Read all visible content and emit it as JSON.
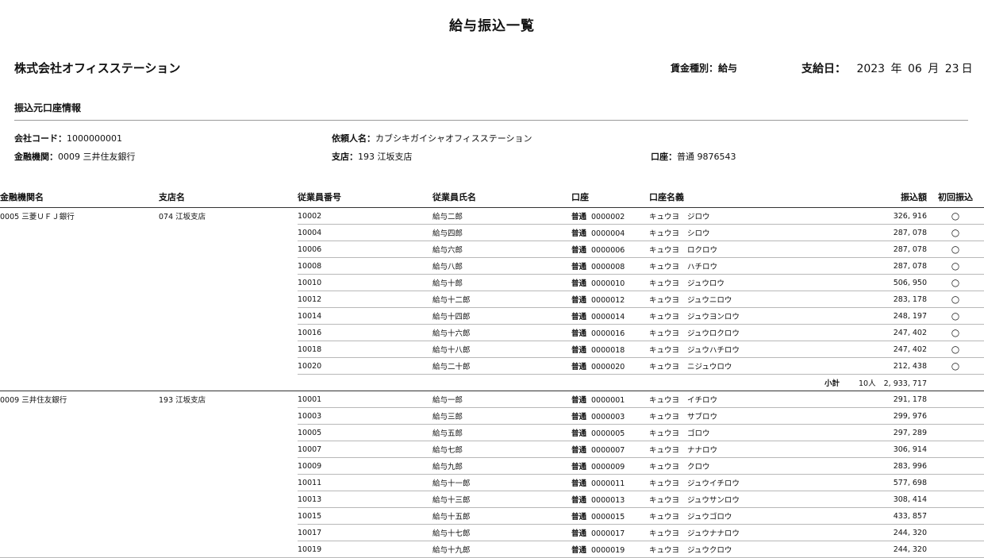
{
  "report": {
    "title": "給与振込一覧",
    "company": "株式会社オフィスステーション",
    "wage_type": "賃金種別：給与",
    "payday_label": "支給日：",
    "pay_year": "2023",
    "year_unit": "年",
    "pay_month": "06",
    "month_unit": "月",
    "pay_day": "23",
    "day_unit": "日"
  },
  "source": {
    "section_title": "振込元口座情報",
    "company_code_label": "会社コード：",
    "company_code": "1000000001",
    "requester_label": "依頼人名：",
    "requester": "カブシキガイシャオフィスステーション",
    "bank_label": "金融機関：",
    "bank": "0009 三井住友銀行",
    "branch_label": "支店：",
    "branch": "193 江坂支店",
    "account_label": "口座：",
    "account": "普通 9876543"
  },
  "columns": {
    "bank": "金融機関名",
    "branch": "支店名",
    "emp_no": "従業員番号",
    "emp_name": "従業員氏名",
    "account": "口座",
    "holder": "口座名義",
    "amount": "振込額",
    "first": "初回振込"
  },
  "groups": [
    {
      "bank": "0005 三菱ＵＦＪ銀行",
      "branch": "074 江坂支店",
      "rows": [
        {
          "emp_no": "10002",
          "name": "給与二郎",
          "acct_type": "普通",
          "acct_no": "0000002",
          "holder_pref": "キュウヨ",
          "holder_name": "ジロウ",
          "amount": "326, 916",
          "first": "○"
        },
        {
          "emp_no": "10004",
          "name": "給与四郎",
          "acct_type": "普通",
          "acct_no": "0000004",
          "holder_pref": "キュウヨ",
          "holder_name": "シロウ",
          "amount": "287, 078",
          "first": "○"
        },
        {
          "emp_no": "10006",
          "name": "給与六郎",
          "acct_type": "普通",
          "acct_no": "0000006",
          "holder_pref": "キュウヨ",
          "holder_name": "ロクロウ",
          "amount": "287, 078",
          "first": "○"
        },
        {
          "emp_no": "10008",
          "name": "給与八郎",
          "acct_type": "普通",
          "acct_no": "0000008",
          "holder_pref": "キュウヨ",
          "holder_name": "ハチロウ",
          "amount": "287, 078",
          "first": "○"
        },
        {
          "emp_no": "10010",
          "name": "給与十郎",
          "acct_type": "普通",
          "acct_no": "0000010",
          "holder_pref": "キュウヨ",
          "holder_name": "ジュウロウ",
          "amount": "506, 950",
          "first": "○"
        },
        {
          "emp_no": "10012",
          "name": "給与十二郎",
          "acct_type": "普通",
          "acct_no": "0000012",
          "holder_pref": "キュウヨ",
          "holder_name": "ジュウニロウ",
          "amount": "283, 178",
          "first": "○"
        },
        {
          "emp_no": "10014",
          "name": "給与十四郎",
          "acct_type": "普通",
          "acct_no": "0000014",
          "holder_pref": "キュウヨ",
          "holder_name": "ジュウヨンロウ",
          "amount": "248, 197",
          "first": "○"
        },
        {
          "emp_no": "10016",
          "name": "給与十六郎",
          "acct_type": "普通",
          "acct_no": "0000016",
          "holder_pref": "キュウヨ",
          "holder_name": "ジュウロクロウ",
          "amount": "247, 402",
          "first": "○"
        },
        {
          "emp_no": "10018",
          "name": "給与十八郎",
          "acct_type": "普通",
          "acct_no": "0000018",
          "holder_pref": "キュウヨ",
          "holder_name": "ジュウハチロウ",
          "amount": "247, 402",
          "first": "○"
        },
        {
          "emp_no": "10020",
          "name": "給与二十郎",
          "acct_type": "普通",
          "acct_no": "0000020",
          "holder_pref": "キュウヨ",
          "holder_name": "ニジュウロウ",
          "amount": "212, 438",
          "first": "○"
        }
      ],
      "subtotal": {
        "label": "小計",
        "count": "10人",
        "amount": "2, 933, 717"
      }
    },
    {
      "bank": "0009 三井住友銀行",
      "branch": "193 江坂支店",
      "rows": [
        {
          "emp_no": "10001",
          "name": "給与一郎",
          "acct_type": "普通",
          "acct_no": "0000001",
          "holder_pref": "キュウヨ",
          "holder_name": "イチロウ",
          "amount": "291, 178",
          "first": ""
        },
        {
          "emp_no": "10003",
          "name": "給与三郎",
          "acct_type": "普通",
          "acct_no": "0000003",
          "holder_pref": "キュウヨ",
          "holder_name": "サブロウ",
          "amount": "299, 976",
          "first": ""
        },
        {
          "emp_no": "10005",
          "name": "給与五郎",
          "acct_type": "普通",
          "acct_no": "0000005",
          "holder_pref": "キュウヨ",
          "holder_name": "ゴロウ",
          "amount": "297, 289",
          "first": ""
        },
        {
          "emp_no": "10007",
          "name": "給与七郎",
          "acct_type": "普通",
          "acct_no": "0000007",
          "holder_pref": "キュウヨ",
          "holder_name": "ナナロウ",
          "amount": "306, 914",
          "first": ""
        },
        {
          "emp_no": "10009",
          "name": "給与九郎",
          "acct_type": "普通",
          "acct_no": "0000009",
          "holder_pref": "キュウヨ",
          "holder_name": "クロウ",
          "amount": "283, 996",
          "first": ""
        },
        {
          "emp_no": "10011",
          "name": "給与十一郎",
          "acct_type": "普通",
          "acct_no": "0000011",
          "holder_pref": "キュウヨ",
          "holder_name": "ジュウイチロウ",
          "amount": "577, 698",
          "first": ""
        },
        {
          "emp_no": "10013",
          "name": "給与十三郎",
          "acct_type": "普通",
          "acct_no": "0000013",
          "holder_pref": "キュウヨ",
          "holder_name": "ジュウサンロウ",
          "amount": "308, 414",
          "first": ""
        },
        {
          "emp_no": "10015",
          "name": "給与十五郎",
          "acct_type": "普通",
          "acct_no": "0000015",
          "holder_pref": "キュウヨ",
          "holder_name": "ジュウゴロウ",
          "amount": "433, 857",
          "first": ""
        },
        {
          "emp_no": "10017",
          "name": "給与十七郎",
          "acct_type": "普通",
          "acct_no": "0000017",
          "holder_pref": "キュウヨ",
          "holder_name": "ジュウナナロウ",
          "amount": "244, 320",
          "first": ""
        },
        {
          "emp_no": "10019",
          "name": "給与十九郎",
          "acct_type": "普通",
          "acct_no": "0000019",
          "holder_pref": "キュウヨ",
          "holder_name": "ジュウクロウ",
          "amount": "244, 320",
          "first": ""
        }
      ]
    }
  ]
}
